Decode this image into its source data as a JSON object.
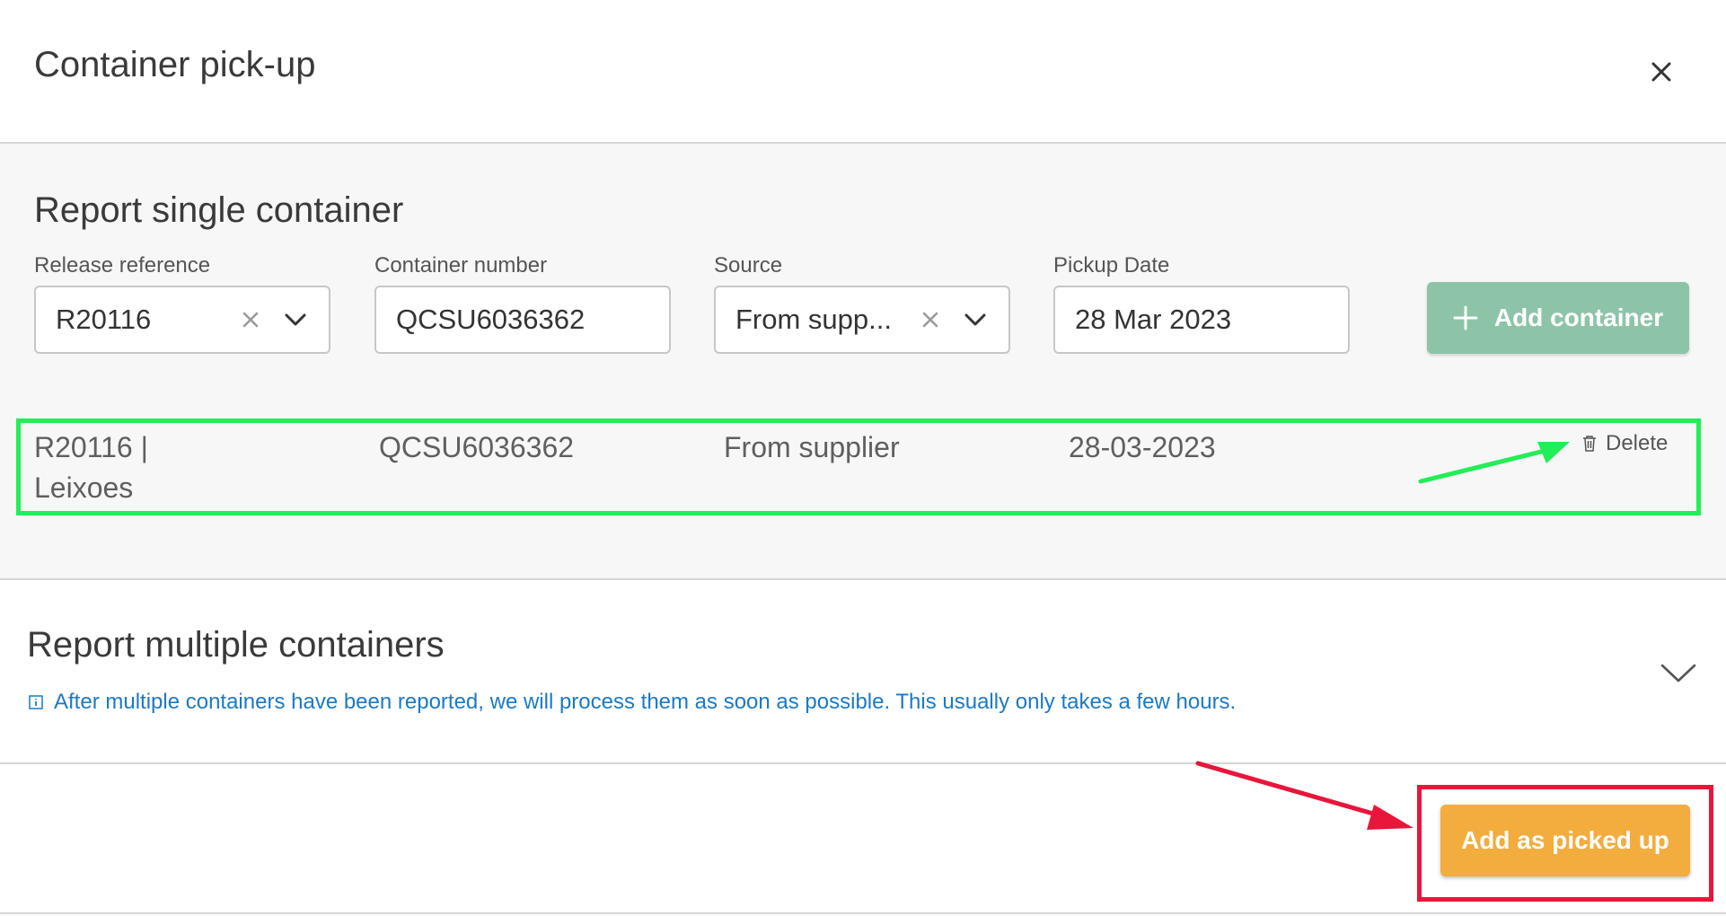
{
  "dialog": {
    "title": "Container pick-up",
    "close_icon": "close-icon"
  },
  "single": {
    "title": "Report single container",
    "fields": {
      "release_reference": {
        "label": "Release reference",
        "value": "R20116"
      },
      "container_number": {
        "label": "Container number",
        "value": "QCSU6036362"
      },
      "source": {
        "label": "Source",
        "value": "From supp..."
      },
      "pickup_date": {
        "label": "Pickup Date",
        "value": "28 Mar 2023"
      }
    },
    "add_button": {
      "label": "Add container",
      "icon": "plus-icon",
      "color": "#8dc4a8"
    },
    "row": {
      "release_line1": "R20116 |",
      "release_line2": "Leixoes",
      "container": "QCSU6036362",
      "source": "From supplier",
      "date": "28-03-2023",
      "delete_label": "Delete",
      "delete_icon": "trash-icon"
    }
  },
  "multiple": {
    "title": "Report multiple containers",
    "info": "After multiple containers have been reported, we will process them as soon as possible. This usually only takes a few hours.",
    "info_icon": "info-icon",
    "expand_icon": "chevron-down-icon"
  },
  "footer": {
    "primary_label": "Add as picked up",
    "primary_color": "#f2ad3e"
  },
  "annotations": {
    "highlight_row_color": "#22ee55",
    "highlight_button_color": "#e8163a"
  }
}
